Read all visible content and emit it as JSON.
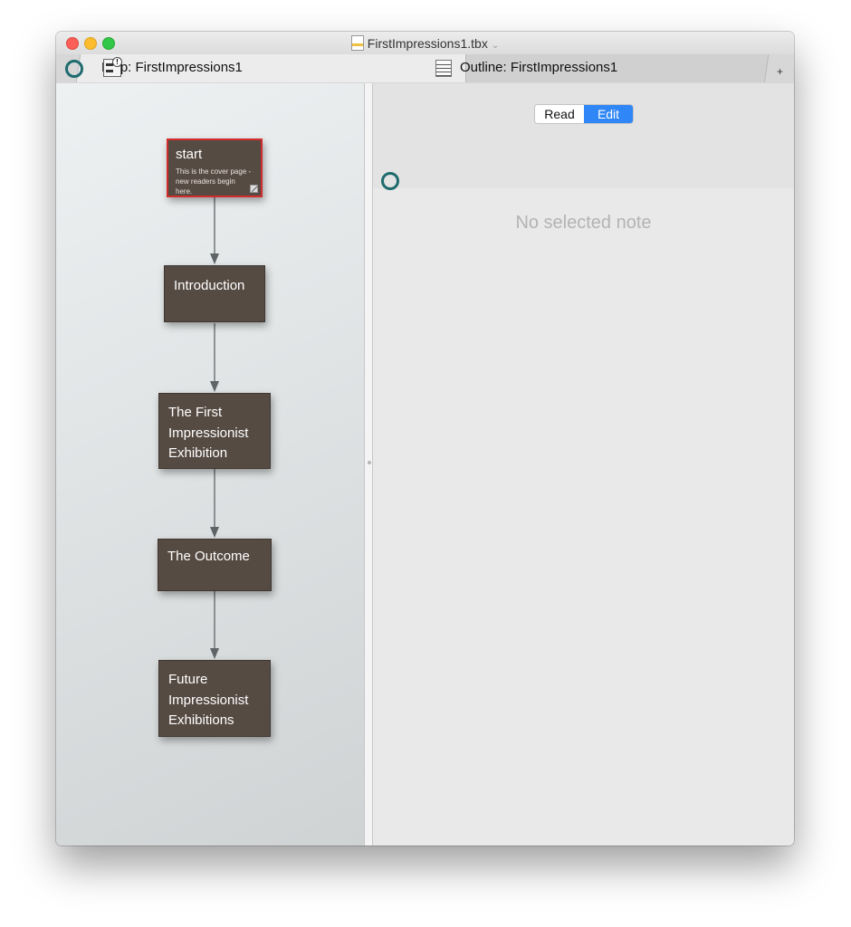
{
  "window": {
    "title": "FirstImpressions1.tbx"
  },
  "tabs": {
    "map_label": "Map: FirstImpressions1",
    "outline_label": "Outline: FirstImpressions1",
    "new_tab": "+"
  },
  "map": {
    "nodes": [
      {
        "title": "start",
        "text": "This is the cover page -\nnew readers begin here."
      },
      {
        "title": "Introduction"
      },
      {
        "title": "The First\nImpressionist\nExhibition"
      },
      {
        "title": "The Outcome"
      },
      {
        "title": "Future\nImpressionist\nExhibitions"
      }
    ]
  },
  "inspector": {
    "read_label": "Read",
    "edit_label": "Edit",
    "selected_mode": "Edit",
    "empty_message": "No selected note"
  },
  "colors": {
    "node_fill": "#564b43",
    "selection_border": "#d22b2b",
    "accent": "#2f86f6",
    "badge_ring": "#1e6b6e"
  }
}
